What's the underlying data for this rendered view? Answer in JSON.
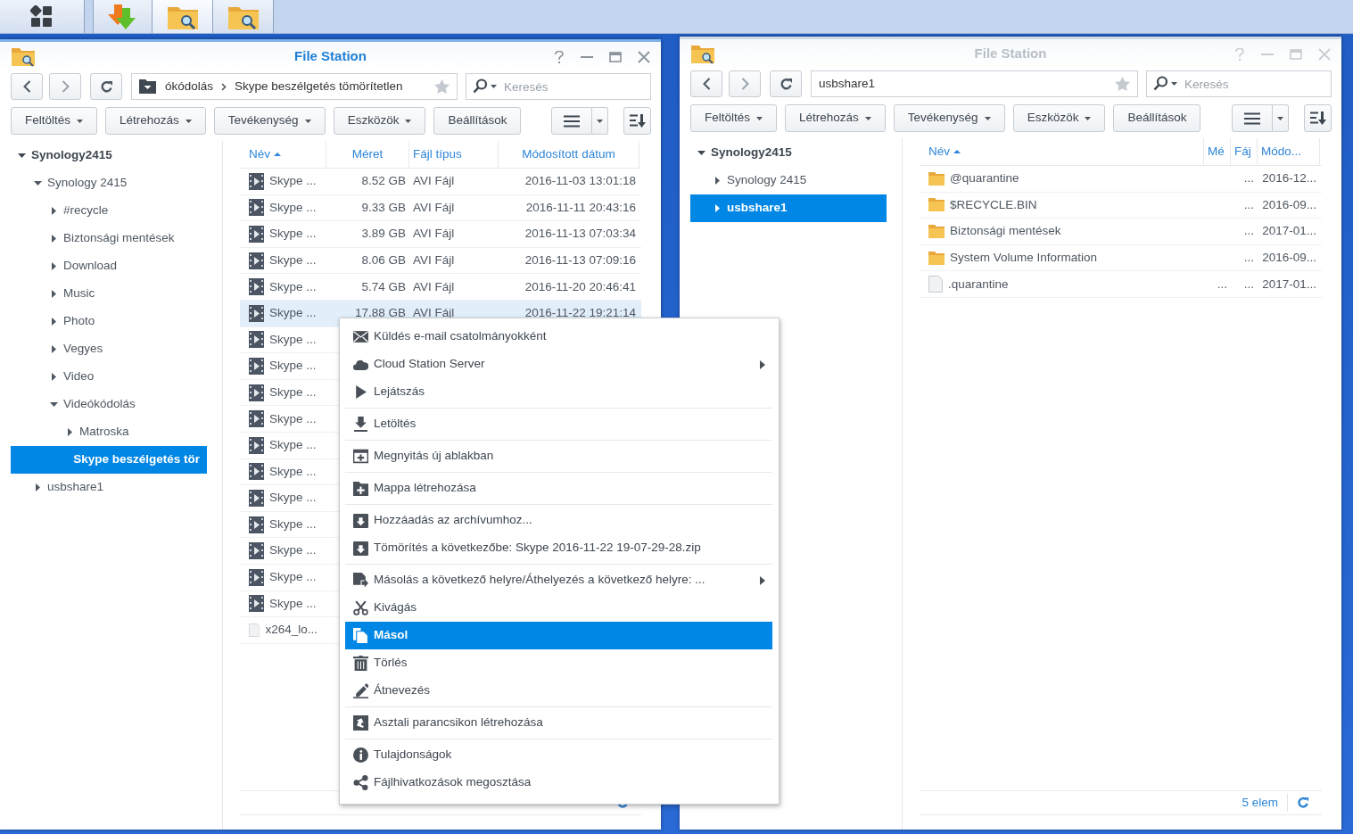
{
  "windows": [
    {
      "title": "File Station",
      "active": true,
      "path_menu": true,
      "path": [
        "ókódolás",
        "Skype beszélgetés tömörítetlen"
      ],
      "search": {
        "placeholder": "Keresés"
      },
      "toolbar": [
        {
          "label": "Feltöltés",
          "dropdown": true
        },
        {
          "label": "Létrehozás",
          "dropdown": true
        },
        {
          "label": "Tevékenység",
          "dropdown": true
        },
        {
          "label": "Eszközök",
          "dropdown": true
        },
        {
          "label": "Beállítások",
          "dropdown": false
        }
      ],
      "tree": [
        {
          "label": "Synology2415",
          "expanded": true,
          "selected": false,
          "children": [
            {
              "label": "Synology 2415",
              "expanded": true,
              "selected": false,
              "children": [
                {
                  "label": "#recycle",
                  "expanded": false,
                  "selected": false
                },
                {
                  "label": "Biztonsági mentések",
                  "expanded": false,
                  "selected": false
                },
                {
                  "label": "Download",
                  "expanded": false,
                  "selected": false
                },
                {
                  "label": "Music",
                  "expanded": false,
                  "selected": false
                },
                {
                  "label": "Photo",
                  "expanded": false,
                  "selected": false
                },
                {
                  "label": "Vegyes",
                  "expanded": false,
                  "selected": false
                },
                {
                  "label": "Video",
                  "expanded": false,
                  "selected": false
                },
                {
                  "label": "Videókódolás",
                  "expanded": true,
                  "selected": false,
                  "children": [
                    {
                      "label": "Matroska",
                      "expanded": false,
                      "selected": false
                    },
                    {
                      "label": "Skype beszélgetés tör",
                      "expanded": false,
                      "leaf": true,
                      "selected": true
                    }
                  ]
                }
              ]
            },
            {
              "label": "usbshare1",
              "expanded": false,
              "selected": false
            }
          ]
        }
      ],
      "columns": [
        {
          "label": "Név",
          "sorted": true
        },
        {
          "label": "Méret",
          "sorted": false
        },
        {
          "label": "Fájl típus",
          "sorted": false
        },
        {
          "label": "Módosított dátum",
          "sorted": false
        }
      ],
      "rows": [
        {
          "kind": "video",
          "name": "Skype ...",
          "size": "8.52 GB",
          "type": "AVI Fájl",
          "modified": "2016-11-03 13:01:18",
          "selected": false
        },
        {
          "kind": "video",
          "name": "Skype ...",
          "size": "9.33 GB",
          "type": "AVI Fájl",
          "modified": "2016-11-11 20:43:16",
          "selected": false
        },
        {
          "kind": "video",
          "name": "Skype ...",
          "size": "3.89 GB",
          "type": "AVI Fájl",
          "modified": "2016-11-13 07:03:34",
          "selected": false
        },
        {
          "kind": "video",
          "name": "Skype ...",
          "size": "8.06 GB",
          "type": "AVI Fájl",
          "modified": "2016-11-13 07:09:16",
          "selected": false
        },
        {
          "kind": "video",
          "name": "Skype ...",
          "size": "5.74 GB",
          "type": "AVI Fájl",
          "modified": "2016-11-20 20:46:41",
          "selected": false
        },
        {
          "kind": "video",
          "name": "Skype ...",
          "size": "17.88 GB",
          "type": "AVI Fájl",
          "modified": "2016-11-22 19:21:14",
          "selected": true
        },
        {
          "kind": "video",
          "name": "Skype ...",
          "selected": false
        },
        {
          "kind": "video",
          "name": "Skype ...",
          "selected": false
        },
        {
          "kind": "video",
          "name": "Skype ...",
          "selected": false
        },
        {
          "kind": "video",
          "name": "Skype ...",
          "selected": false
        },
        {
          "kind": "video",
          "name": "Skype ...",
          "selected": false
        },
        {
          "kind": "video",
          "name": "Skype ...",
          "selected": false
        },
        {
          "kind": "video",
          "name": "Skype ...",
          "selected": false
        },
        {
          "kind": "video",
          "name": "Skype ...",
          "selected": false
        },
        {
          "kind": "video",
          "name": "Skype ...",
          "selected": false
        },
        {
          "kind": "video",
          "name": "Skype ...",
          "selected": false
        },
        {
          "kind": "video",
          "name": "Skype ...",
          "selected": false
        },
        {
          "kind": "file",
          "name": "x264_lo...",
          "selected": false
        }
      ],
      "status": {
        "refresh": true
      }
    },
    {
      "title": "File Station",
      "active": false,
      "path_menu": false,
      "path": [
        "usbshare1"
      ],
      "search": {
        "placeholder": "Keresés"
      },
      "toolbar": [
        {
          "label": "Feltöltés",
          "dropdown": true
        },
        {
          "label": "Létrehozás",
          "dropdown": true
        },
        {
          "label": "Tevékenység",
          "dropdown": true
        },
        {
          "label": "Eszközök",
          "dropdown": true
        },
        {
          "label": "Beállítások",
          "dropdown": false
        }
      ],
      "tree": [
        {
          "label": "Synology2415",
          "expanded": true,
          "selected": false,
          "children": [
            {
              "label": "Synology 2415",
              "expanded": false,
              "selected": false
            },
            {
              "label": "usbshare1",
              "expanded": false,
              "selected": true
            }
          ]
        }
      ],
      "columns": [
        {
          "label": "Név",
          "sorted": true
        },
        {
          "label": "Mé",
          "sorted": false
        },
        {
          "label": "Fáj",
          "sorted": false
        },
        {
          "label": "Módo...",
          "sorted": false
        }
      ],
      "rows": [
        {
          "kind": "folder",
          "name": "@quarantine",
          "type": "...",
          "modified": "2016-12...",
          "selected": false
        },
        {
          "kind": "folder",
          "name": "$RECYCLE.BIN",
          "type": "...",
          "modified": "2016-09...",
          "selected": false
        },
        {
          "kind": "folder",
          "name": "Biztonsági mentések",
          "type": "...",
          "modified": "2017-01...",
          "selected": false
        },
        {
          "kind": "folder",
          "name": "System Volume Information",
          "type": "...",
          "modified": "2016-09...",
          "selected": false
        },
        {
          "kind": "file",
          "name": ".quarantine",
          "size": "...",
          "type": "...",
          "modified": "2017-01...",
          "selected": false
        }
      ],
      "status": {
        "count": "5 elem",
        "refresh": true
      }
    }
  ],
  "context_menu": {
    "groups": [
      [
        {
          "label": "Küldés e-mail csatolmányokként",
          "submenu": false,
          "selected": false
        },
        {
          "label": "Cloud Station Server",
          "submenu": true,
          "selected": false
        },
        {
          "label": "Lejátszás",
          "submenu": false,
          "selected": false
        }
      ],
      [
        {
          "label": "Letöltés",
          "submenu": false,
          "selected": false
        }
      ],
      [
        {
          "label": "Megnyitás új ablakban",
          "submenu": false,
          "selected": false
        }
      ],
      [
        {
          "label": "Mappa létrehozása",
          "submenu": false,
          "selected": false
        }
      ],
      [
        {
          "label": "Hozzáadás az archívumhoz...",
          "submenu": false,
          "selected": false
        },
        {
          "label": "Tömörítés a következőbe: Skype 2016-11-22 19-07-29-28.zip",
          "submenu": false,
          "selected": false
        }
      ],
      [
        {
          "label": "Másolás a következő helyre/Áthelyezés a következő helyre: ...",
          "submenu": true,
          "selected": false
        },
        {
          "label": "Kivágás",
          "submenu": false,
          "selected": false
        },
        {
          "label": "Másol",
          "submenu": false,
          "selected": true
        },
        {
          "label": "Törlés",
          "submenu": false,
          "selected": false
        },
        {
          "label": "Átnevezés",
          "submenu": false,
          "selected": false
        }
      ],
      [
        {
          "label": "Asztali parancsikon létrehozása",
          "submenu": false,
          "selected": false
        }
      ],
      [
        {
          "label": "Tulajdonságok",
          "submenu": false,
          "selected": false
        },
        {
          "label": "Fájlhivatkozások megosztása",
          "submenu": false,
          "selected": false
        }
      ]
    ]
  }
}
